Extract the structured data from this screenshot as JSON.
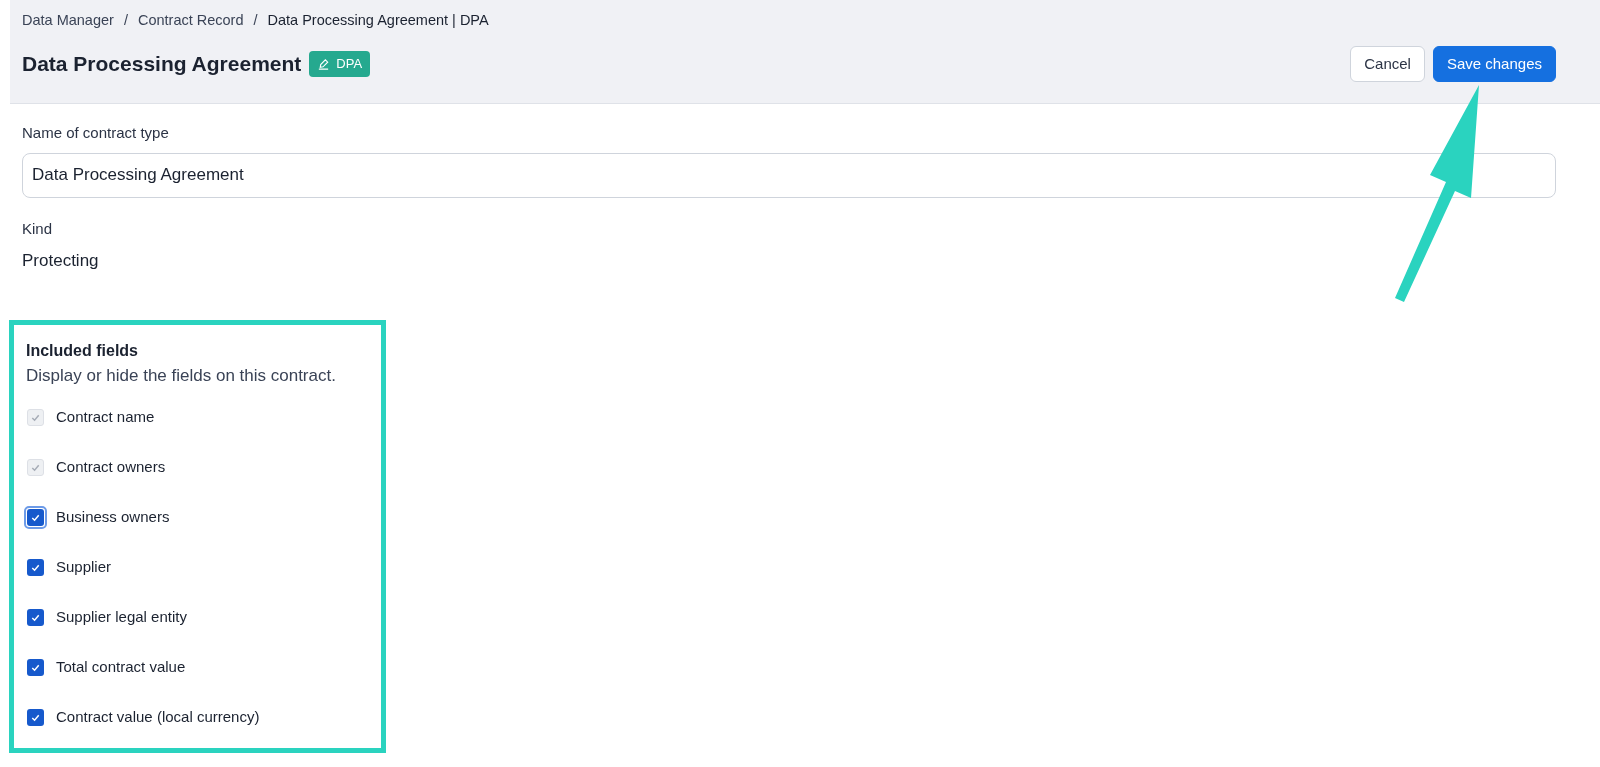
{
  "breadcrumb": [
    {
      "label": "Data Manager",
      "current": false
    },
    {
      "label": "Contract Record",
      "current": false
    },
    {
      "label": "Data Processing Agreement | DPA",
      "current": true
    }
  ],
  "breadcrumb_separator": "/",
  "header": {
    "title": "Data Processing Agreement",
    "badge": "DPA",
    "buttons": [
      {
        "label": "Cancel",
        "kind": "secondary"
      },
      {
        "label": "Save changes",
        "kind": "primary"
      }
    ]
  },
  "name_field": {
    "label": "Name of contract type",
    "value": "Data Processing Agreement"
  },
  "kind": {
    "label": "Kind",
    "value": "Protecting"
  },
  "included_fields": {
    "title": "Included fields",
    "description": "Display or hide the fields on this contract.",
    "items": [
      {
        "label": "Contract name",
        "checked": true,
        "disabled": true,
        "focused": false
      },
      {
        "label": "Contract owners",
        "checked": true,
        "disabled": true,
        "focused": false
      },
      {
        "label": "Business owners",
        "checked": true,
        "disabled": false,
        "focused": true
      },
      {
        "label": "Supplier",
        "checked": true,
        "disabled": false,
        "focused": false
      },
      {
        "label": "Supplier legal entity",
        "checked": true,
        "disabled": false,
        "focused": false
      },
      {
        "label": "Total contract value",
        "checked": true,
        "disabled": false,
        "focused": false
      },
      {
        "label": "Contract value (local currency)",
        "checked": true,
        "disabled": false,
        "focused": false
      }
    ]
  }
}
